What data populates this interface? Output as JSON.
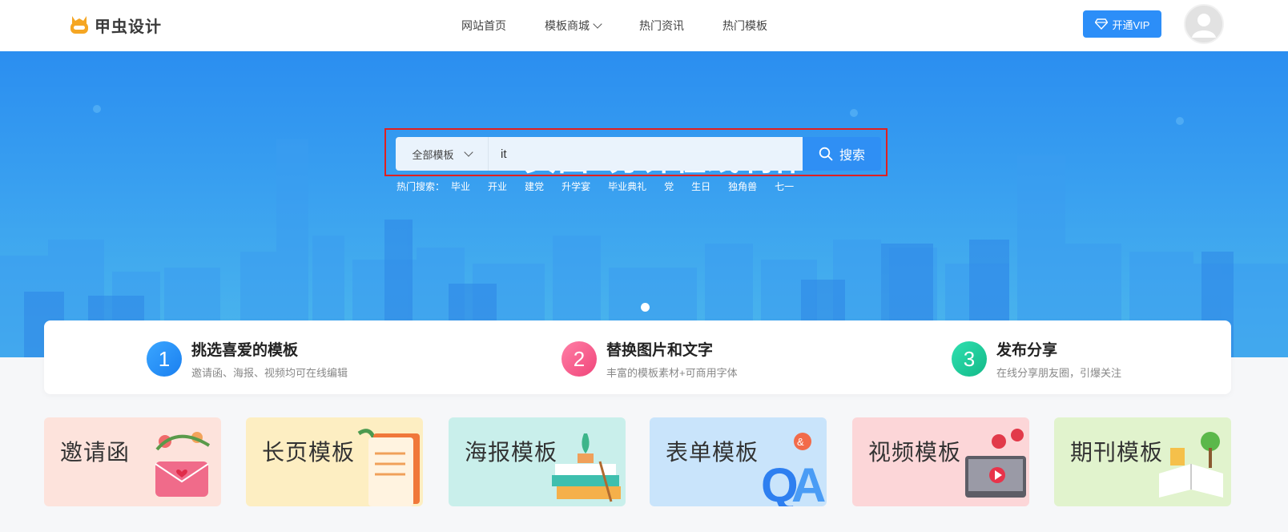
{
  "header": {
    "logo_text": "甲虫设计",
    "nav": [
      {
        "label": "网站首页"
      },
      {
        "label": "模板商城"
      },
      {
        "label": "热门资讯"
      },
      {
        "label": "热门模板"
      }
    ],
    "vip_label": "开通VIP"
  },
  "banner": {
    "title": "H5页面3分钟在线制作",
    "search": {
      "category": "全部模板",
      "query": "it",
      "button": "搜索"
    },
    "hot_label": "热门搜索：",
    "hot_terms": [
      "毕业",
      "开业",
      "建党",
      "升学宴",
      "毕业典礼",
      "党",
      "生日",
      "独角兽",
      "七一"
    ]
  },
  "steps": [
    {
      "num": "1",
      "title": "挑选喜爱的模板",
      "desc": "邀请函、海报、视频均可在线编辑"
    },
    {
      "num": "2",
      "title": "替换图片和文字",
      "desc": "丰富的模板素材+可商用字体"
    },
    {
      "num": "3",
      "title": "发布分享",
      "desc": "在线分享朋友圈，引爆关注"
    }
  ],
  "cards": [
    {
      "label": "邀请函"
    },
    {
      "label": "长页模板"
    },
    {
      "label": "海报模板"
    },
    {
      "label": "表单模板"
    },
    {
      "label": "视频模板"
    },
    {
      "label": "期刊模板"
    }
  ],
  "colors": {
    "accent": "#2c8ef8",
    "highlight_box": "#e02020"
  }
}
